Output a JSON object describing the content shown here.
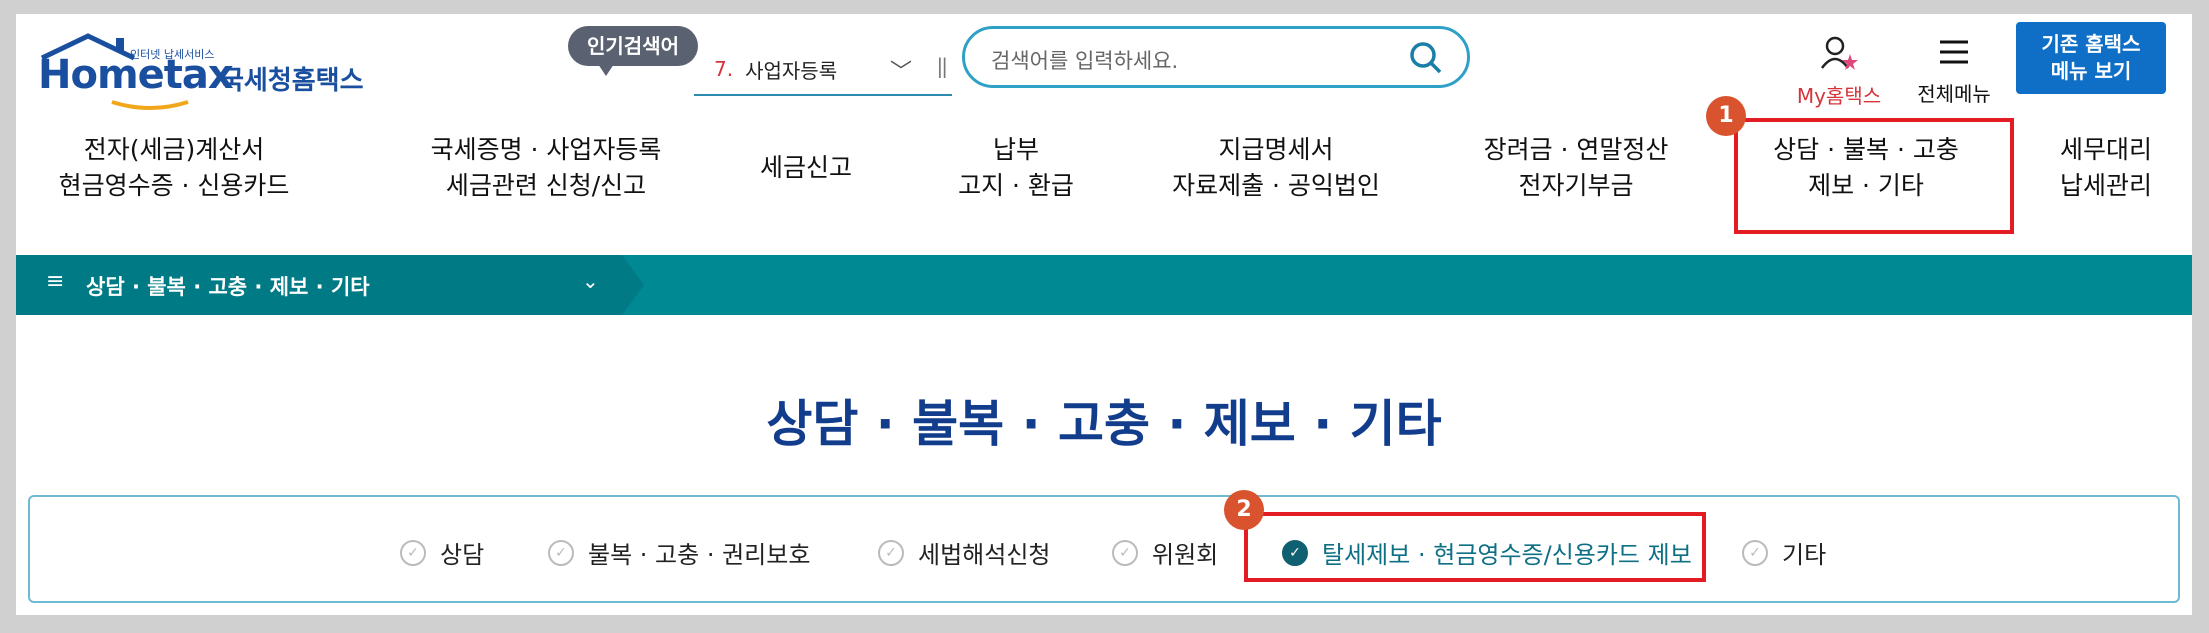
{
  "header": {
    "logo_en": "Hometax",
    "logo_ko": "국세청홈택스",
    "logo_tag": "인터넷 납세서비스",
    "popular_badge": "인기검색어",
    "popular_num": "7.",
    "popular_term": "사업자등록",
    "search_placeholder": "검색어를 입력하세요.",
    "my_label": "My홈택스",
    "all_menu_label": "전체메뉴",
    "old_btn_line1": "기존 홈택스",
    "old_btn_line2": "메뉴 보기"
  },
  "nav": [
    {
      "line1": "전자(세금)계산서",
      "line2": "현금영수증 · 신용카드"
    },
    {
      "line1": "국세증명 · 사업자등록",
      "line2": "세금관련 신청/신고"
    },
    {
      "line1": "세금신고",
      "line2": ""
    },
    {
      "line1": "납부",
      "line2": "고지 · 환급"
    },
    {
      "line1": "지급명세서",
      "line2": "자료제출 · 공익법인"
    },
    {
      "line1": "장려금 · 연말정산",
      "line2": "전자기부금"
    },
    {
      "line1": "상담 · 불복 · 고충",
      "line2": "제보 · 기타"
    },
    {
      "line1": "세무대리",
      "line2": "납세관리"
    }
  ],
  "annotations": {
    "one": "1",
    "two": "2"
  },
  "breadcrumb": {
    "label": "상담 · 불복 · 고충 · 제보 · 기타"
  },
  "page_title": "상담 · 불복 · 고충 · 제보 · 기타",
  "subtabs": [
    {
      "label": "상담",
      "active": false
    },
    {
      "label": "불복 · 고충 · 권리보호",
      "active": false
    },
    {
      "label": "세법해석신청",
      "active": false
    },
    {
      "label": "위원회",
      "active": false
    },
    {
      "label": "탈세제보 · 현금영수증/신용카드 제보",
      "active": true
    },
    {
      "label": "기타",
      "active": false
    }
  ],
  "colors": {
    "accent": "#008893",
    "highlight": "#e31b23",
    "brand": "#1a4fa0"
  }
}
